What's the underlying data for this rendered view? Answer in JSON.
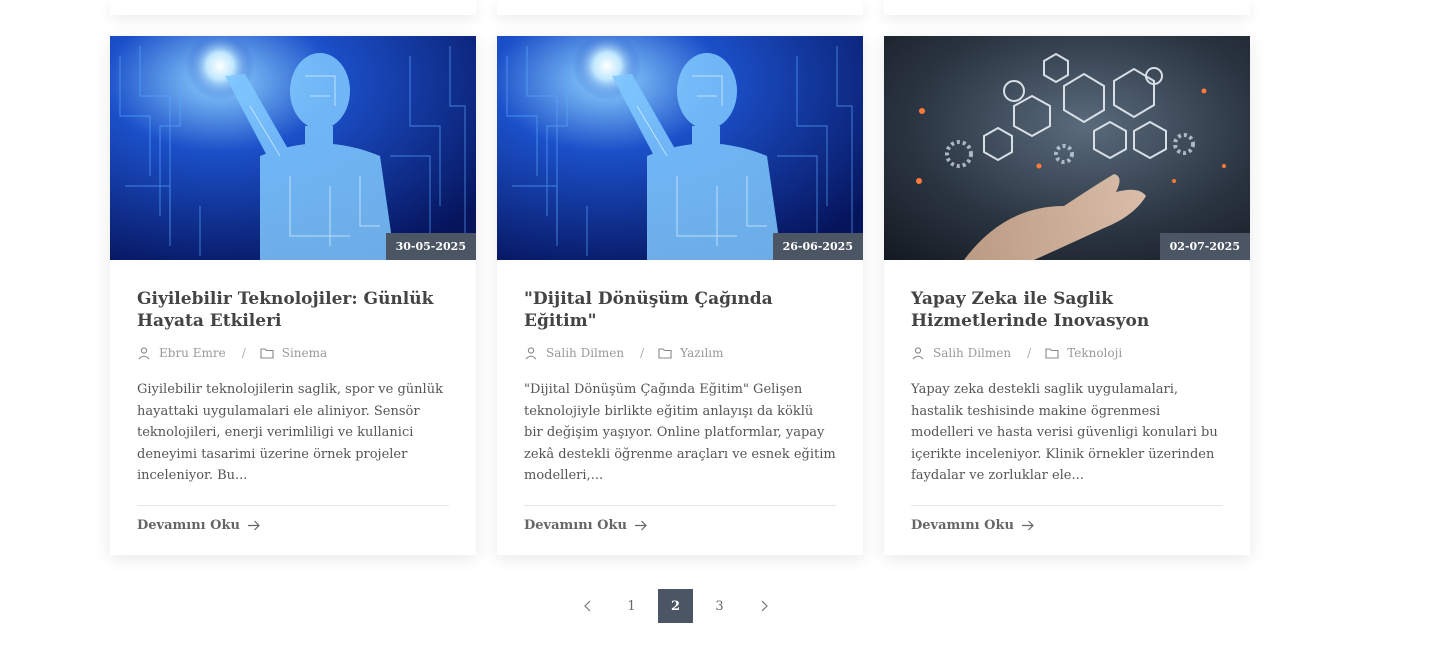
{
  "posts": [
    {
      "date": "30-05-2025",
      "title": "Giyilebilir Teknolojiler: Günlük Hayata Etkileri",
      "author": "Ebru Emre",
      "category": "Sinema",
      "excerpt": "Giyilebilir teknolojilerin saglik, spor ve günlük hayattaki uygulamalari ele aliniyor. Sensör teknolojileri, enerji verimliligi ve kullanici deneyimi tasarimi üzerine örnek projeler inceleniyor. Bu...",
      "read_more": "Devamını Oku",
      "image": "circuit-human"
    },
    {
      "date": "26-06-2025",
      "title": "\"Dijital Dönüşüm Çağında Eğitim\"",
      "author": "Salih Dilmen",
      "category": "Yazılım",
      "excerpt": "\"Dijital Dönüşüm Çağında Eğitim\" Gelişen teknolojiyle birlikte eğitim anlayışı da köklü bir değişim yaşıyor. Online platformlar, yapay zekâ destekli öğrenme araçları ve esnek eğitim modelleri,...",
      "read_more": "Devamını Oku",
      "image": "circuit-human"
    },
    {
      "date": "02-07-2025",
      "title": "Yapay Zeka ile Saglik Hizmetlerinde Inovasyon",
      "author": "Salih Dilmen",
      "category": "Teknoloji",
      "excerpt": "Yapay zeka destekli saglik uygulamalari, hastalik teshisinde makine ögrenmesi modelleri ve hasta verisi güvenligi konulari bu içerikte inceleniyor. Klinik örnekler üzerinden faydalar ve zorluklar ele...",
      "read_more": "Devamını Oku",
      "image": "hand-hexagons"
    }
  ],
  "icons": {
    "author": "user-icon",
    "category": "folder-icon",
    "read_more": "arrow-right-icon",
    "prev": "chevron-left-icon",
    "next": "chevron-right-icon"
  },
  "pagination": {
    "pages": [
      "1",
      "2",
      "3"
    ],
    "current": "2"
  },
  "colors": {
    "badge": "#4b5563",
    "active_page": "#4b5563"
  }
}
